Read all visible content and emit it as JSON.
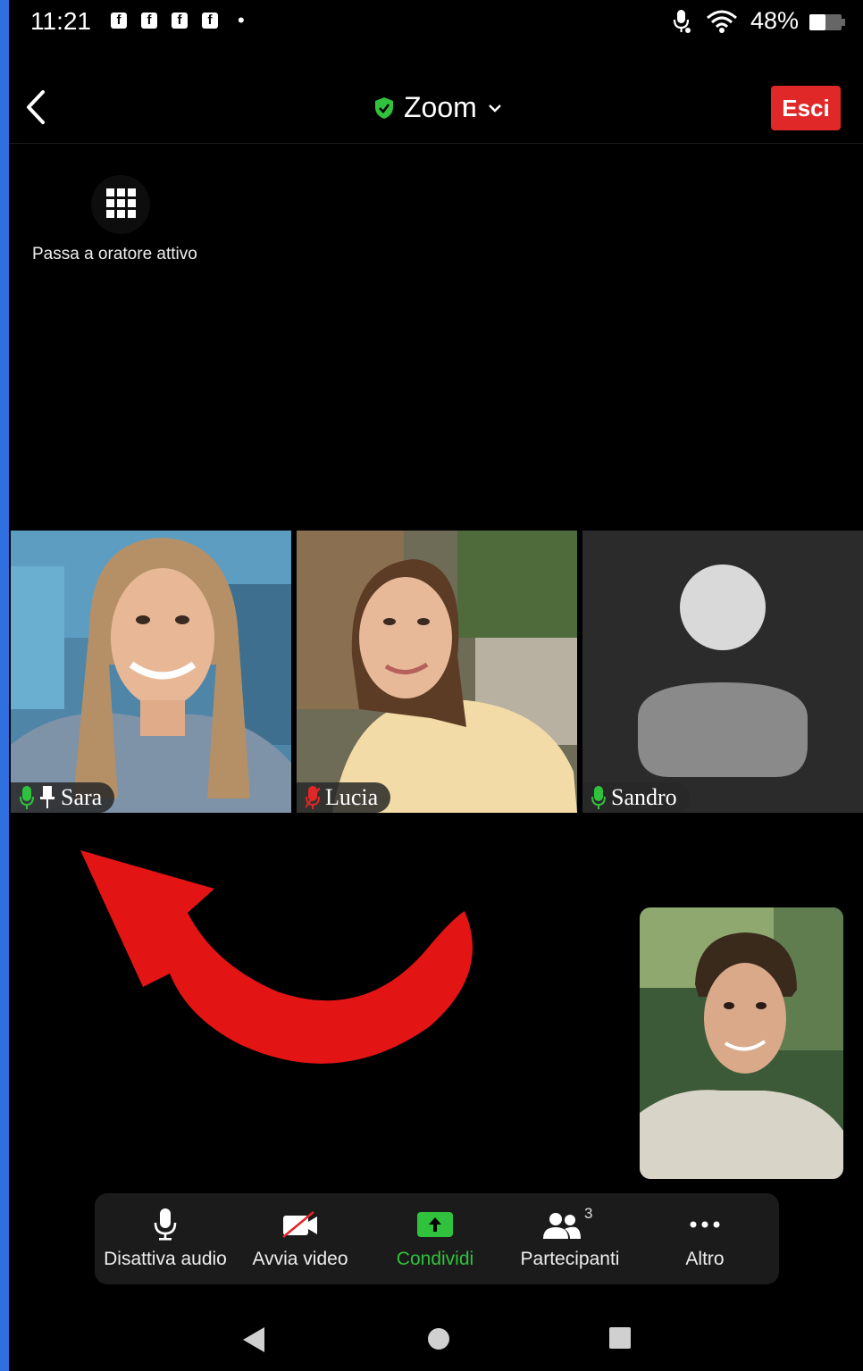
{
  "status_bar": {
    "time": "11:21",
    "notification_icons": [
      "facebook-icon",
      "facebook-icon",
      "facebook-icon",
      "facebook-icon"
    ],
    "more_dot": "•",
    "battery_percent": "48%"
  },
  "header": {
    "title": "Zoom",
    "leave_label": "Esci",
    "colors": {
      "leave": "#e02828",
      "shield": "#31c23d"
    }
  },
  "switch_view": {
    "label": "Passa a oratore attivo"
  },
  "participants": [
    {
      "name": "Sara",
      "mic": "on",
      "pinned": true
    },
    {
      "name": "Lucia",
      "mic": "muted",
      "pinned": false
    },
    {
      "name": "Sandro",
      "mic": "on",
      "pinned": false,
      "video": "off"
    }
  ],
  "toolbar": {
    "mute_label": "Disattiva audio",
    "video_label": "Avvia video",
    "share_label": "Condividi",
    "participants_label": "Partecipanti",
    "participants_count": "3",
    "more_label": "Altro",
    "colors": {
      "share": "#31c23d"
    }
  }
}
